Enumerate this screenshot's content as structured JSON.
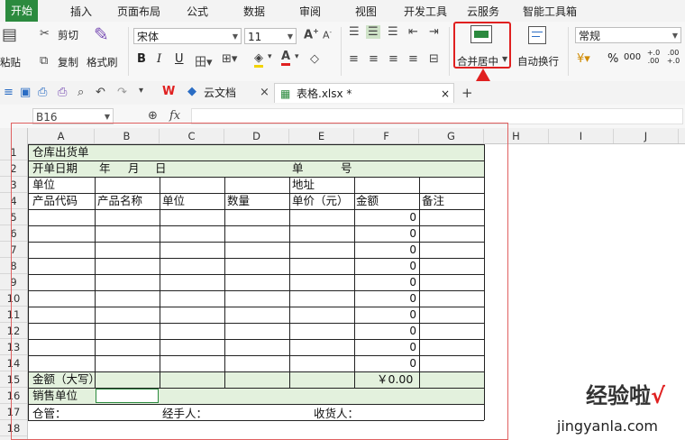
{
  "menu": {
    "tabs": [
      "开始",
      "插入",
      "页面布局",
      "公式",
      "数据",
      "审阅",
      "视图",
      "开发工具",
      "云服务",
      "智能工具箱"
    ],
    "active": "开始"
  },
  "ribbon": {
    "cut": "剪切",
    "paste": "粘贴",
    "copy": "复制",
    "format_painter": "格式刷",
    "font_name": "宋体",
    "font_size": "11",
    "merge_center": "合并居中",
    "wrap_text": "自动换行",
    "number_format": "常规",
    "bold": "B",
    "italic": "I",
    "underline": "U",
    "percent": "%",
    "increase_decimal": "+.0 .00",
    "decrease_decimal": ".00 +.0",
    "thousands": "000"
  },
  "docs_tabs": {
    "cloud_docs": "云文档",
    "workbook": "表格.xlsx *"
  },
  "formula_bar": {
    "name_box": "B16",
    "fx": "fx"
  },
  "columns": [
    "A",
    "B",
    "C",
    "D",
    "E",
    "F",
    "G",
    "H",
    "I",
    "J"
  ],
  "rows": [
    "1",
    "2",
    "3",
    "4",
    "5",
    "6",
    "7",
    "8",
    "9",
    "10",
    "11",
    "12",
    "13",
    "14",
    "15",
    "16",
    "17",
    "18"
  ],
  "form": {
    "title": "仓库出货单",
    "open_date_label": "开单日期",
    "date_year": "年",
    "date_month": "月",
    "date_day": "日",
    "number_label_1": "单",
    "number_label_2": "号",
    "unit_label": "单位",
    "address_label": "地址",
    "headers": [
      "产品代码",
      "产品名称",
      "单位",
      "数量",
      "单价（元）",
      "金额",
      "备注"
    ],
    "amount_values": [
      "0",
      "0",
      "0",
      "0",
      "0",
      "0",
      "0",
      "0",
      "0",
      "0"
    ],
    "total_label": "金额（大写）",
    "total_value": "￥0.00",
    "sales_unit_label": "销售单位",
    "warehouse_label": "仓管：",
    "handler_label": "经手人：",
    "receiver_label": "收货人："
  },
  "watermark": {
    "cn": "经验啦",
    "check": "√",
    "en": "jingyanla.com"
  },
  "colors": {
    "accent_green": "#2b8a3e",
    "highlight_red": "#e02020",
    "row_green": "#e3f1dd"
  }
}
